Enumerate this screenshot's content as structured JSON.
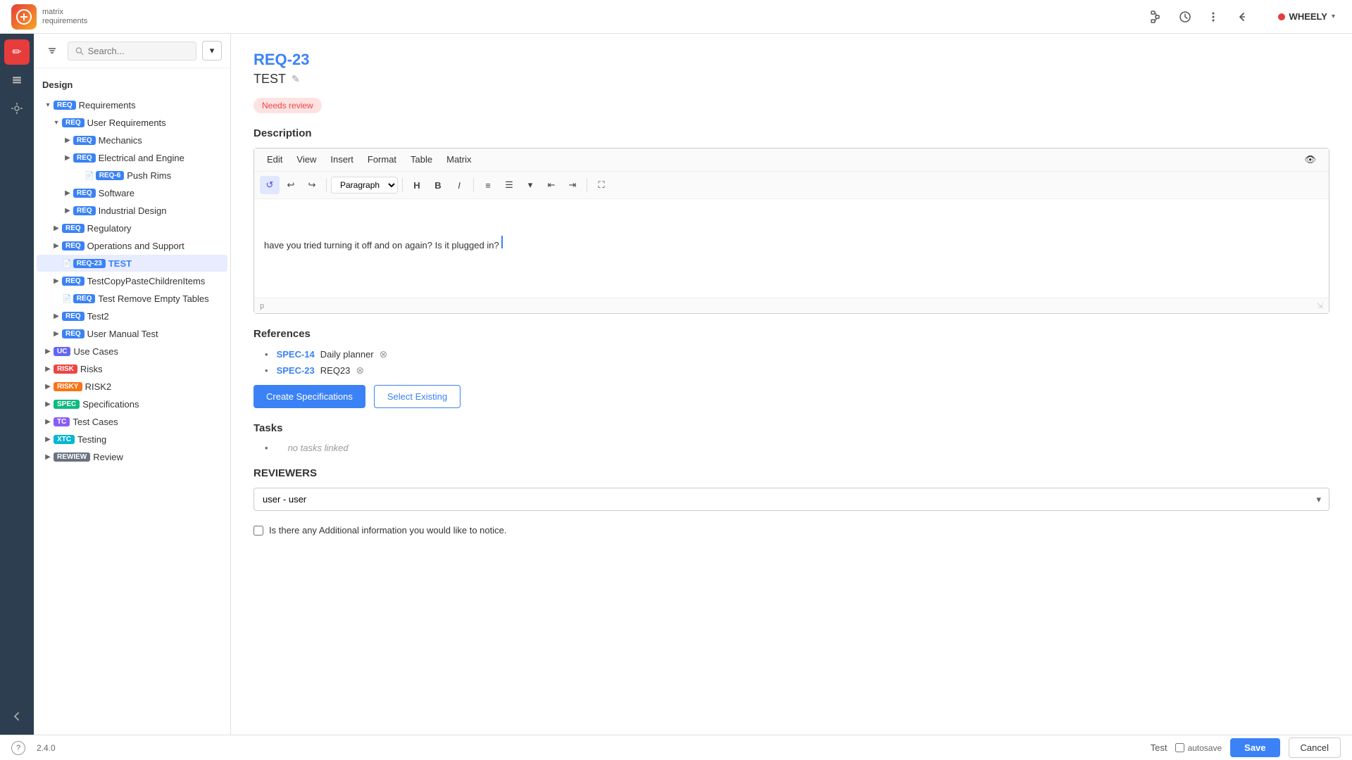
{
  "topbar": {
    "logo_initials": "mr",
    "logo_line1": "matrix",
    "logo_line2": "requirements",
    "user_name": "WHEELY",
    "user_chevron": "▾"
  },
  "icon_rail": {
    "icons": [
      {
        "name": "edit-icon",
        "symbol": "✏",
        "active": true
      },
      {
        "name": "layers-icon",
        "symbol": "⊞",
        "active": false
      },
      {
        "name": "settings-icon",
        "symbol": "✱",
        "active": false
      }
    ],
    "bottom_icon": {
      "name": "collapse-icon",
      "symbol": "←"
    }
  },
  "sidebar": {
    "search_placeholder": "Search...",
    "section_title": "Design",
    "tree": [
      {
        "id": "req-root",
        "label": "Requirements",
        "badge": "REQ",
        "badge_class": "badge-req",
        "indent": 0,
        "expanded": true,
        "toggle": "▾"
      },
      {
        "id": "req-user",
        "label": "User Requirements",
        "badge": "REQ",
        "badge_class": "badge-req",
        "indent": 1,
        "expanded": true,
        "toggle": "▾"
      },
      {
        "id": "req-mechanics",
        "label": "Mechanics",
        "badge": "REQ",
        "badge_class": "badge-req",
        "indent": 2,
        "expanded": false,
        "toggle": "▶"
      },
      {
        "id": "req-electrical",
        "label": "Electrical and Engine",
        "badge": "REQ",
        "badge_class": "badge-req",
        "indent": 2,
        "expanded": false,
        "toggle": "▶",
        "sub": true
      },
      {
        "id": "req-pushrim",
        "label": "Push Rims",
        "badge": "REQ-6",
        "badge_class": "badge-req",
        "indent": 3,
        "is_doc": true
      },
      {
        "id": "req-software",
        "label": "Software",
        "badge": "REQ",
        "badge_class": "badge-req",
        "indent": 2,
        "expanded": false,
        "toggle": "▶"
      },
      {
        "id": "req-industrial",
        "label": "Industrial Design",
        "badge": "REQ",
        "badge_class": "badge-req",
        "indent": 2,
        "expanded": false,
        "toggle": "▶"
      },
      {
        "id": "req-regulatory",
        "label": "Regulatory",
        "badge": "REQ",
        "badge_class": "badge-req",
        "indent": 1,
        "expanded": false,
        "toggle": "▶"
      },
      {
        "id": "req-operations",
        "label": "Operations and Support",
        "badge": "REQ",
        "badge_class": "badge-req",
        "indent": 1,
        "expanded": false,
        "toggle": "▶"
      },
      {
        "id": "req-23",
        "label": "TEST",
        "badge": "REQ-23",
        "badge_class": "badge-req",
        "indent": 1,
        "active": true,
        "is_doc": true
      },
      {
        "id": "req-testcopy",
        "label": "TestCopyPasteChildrenItems",
        "badge": "REQ",
        "badge_class": "badge-req",
        "indent": 1,
        "expanded": false,
        "toggle": "▶"
      },
      {
        "id": "req-testremove",
        "label": "Test Remove Empty Tables",
        "badge": "REQ",
        "badge_class": "badge-req",
        "indent": 1,
        "is_doc": true
      },
      {
        "id": "req-test2",
        "label": "Test2",
        "badge": "REQ",
        "badge_class": "badge-req",
        "indent": 1,
        "expanded": false,
        "toggle": "▶"
      },
      {
        "id": "req-usermanual",
        "label": "User Manual Test",
        "badge": "REQ",
        "badge_class": "badge-req",
        "indent": 1,
        "expanded": false,
        "toggle": "▶"
      },
      {
        "id": "uc-root",
        "label": "Use Cases",
        "badge": "UC",
        "badge_class": "badge-uc",
        "indent": 0,
        "expanded": false,
        "toggle": "▶"
      },
      {
        "id": "risk-root",
        "label": "Risks",
        "badge": "RISK",
        "badge_class": "badge-risk",
        "indent": 0,
        "expanded": false,
        "toggle": "▶"
      },
      {
        "id": "risky-root",
        "label": "RISK2",
        "badge": "RISKY",
        "badge_class": "badge-risky",
        "indent": 0,
        "expanded": false,
        "toggle": "▶"
      },
      {
        "id": "spec-root",
        "label": "Specifications",
        "badge": "SPEC",
        "badge_class": "badge-spec",
        "indent": 0,
        "expanded": false,
        "toggle": "▶"
      },
      {
        "id": "tc-root",
        "label": "Test Cases",
        "badge": "TC",
        "badge_class": "badge-tc",
        "indent": 0,
        "expanded": false,
        "toggle": "▶"
      },
      {
        "id": "xtc-root",
        "label": "Testing",
        "badge": "XTC",
        "badge_class": "badge-xtc",
        "indent": 0,
        "expanded": false,
        "toggle": "▶"
      },
      {
        "id": "rewiew-root",
        "label": "Review",
        "badge": "REWIEW",
        "badge_class": "badge-rewiew",
        "indent": 0,
        "expanded": false,
        "toggle": "▶"
      }
    ]
  },
  "main": {
    "doc_id": "REQ-23",
    "doc_name": "TEST",
    "status": "Needs review",
    "description_title": "Description",
    "editor_menu": [
      "Edit",
      "View",
      "Insert",
      "Format",
      "Table",
      "Matrix"
    ],
    "editor_content": "have you tried turning it off and on again? Is it plugged in?",
    "editor_footer_tag": "p",
    "paragraph_style": "Paragraph",
    "references_title": "References",
    "references": [
      {
        "id": "SPEC-14",
        "label": "Daily planner"
      },
      {
        "id": "SPEC-23",
        "label": "REQ23"
      }
    ],
    "btn_create_spec": "Create Specifications",
    "btn_select_existing": "Select Existing",
    "tasks_title": "Tasks",
    "no_tasks_text": "no tasks linked",
    "reviewers_title": "REVIEWERS",
    "reviewer_value": "user - user",
    "checkbox_label": "Is there any Additional information you would like to notice.",
    "version": "2.4.0",
    "bottom_status": "Test",
    "autosave_label": "autosave",
    "btn_save": "Save",
    "btn_cancel": "Cancel"
  }
}
